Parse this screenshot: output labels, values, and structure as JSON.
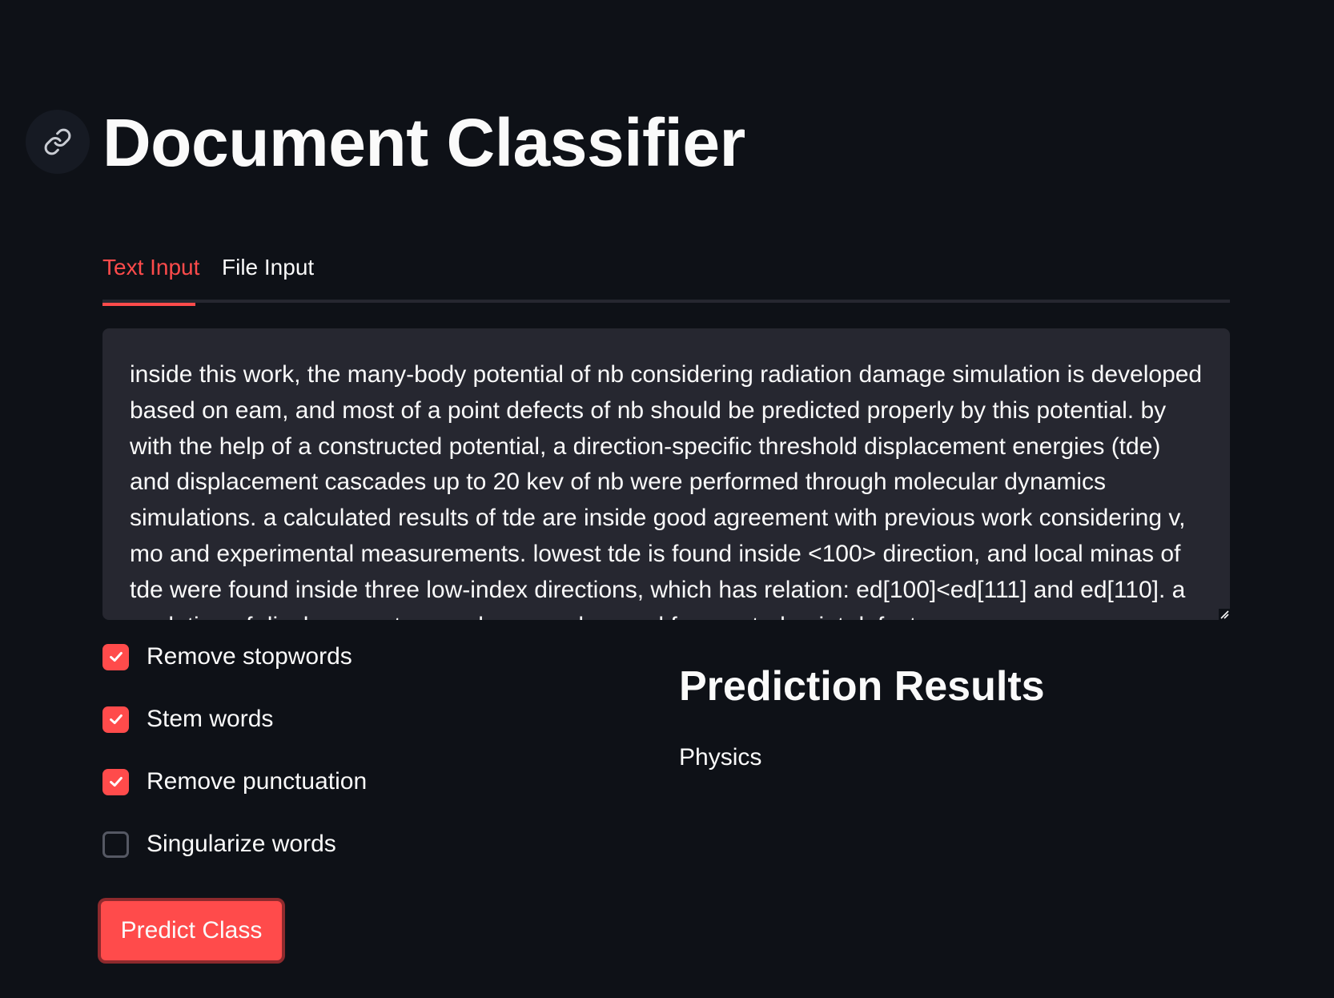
{
  "page": {
    "title": "Document Classifier",
    "anchor_icon": "link-icon"
  },
  "tabs": [
    {
      "label": "Text Input",
      "active": true
    },
    {
      "label": "File Input",
      "active": false
    }
  ],
  "text_input": {
    "value": "inside this work, the many-body potential of nb considering radiation damage simulation is developed based on eam, and most of a point defects of nb should be predicted properly by this potential. by with the help of a constructed potential, a direction-specific threshold displacement energies (tde) and displacement cascades up to 20 kev of nb were performed through molecular dynamics simulations. a calculated results of tde are inside good agreement with previous work considering v, mo and experimental measurements. lowest tde is found inside <100> direction, and local minas of tde were found inside three low-index directions, which has relation: ed[100]<ed[111] and ed[110]. a evolution of displacement cascades was observed for created point defects"
  },
  "options": [
    {
      "label": "Remove stopwords",
      "checked": true
    },
    {
      "label": "Stem words",
      "checked": true
    },
    {
      "label": "Remove punctuation",
      "checked": true
    },
    {
      "label": "Singularize words",
      "checked": false
    }
  ],
  "predict_button": {
    "label": "Predict Class"
  },
  "results": {
    "title": "Prediction Results",
    "value": "Physics"
  },
  "colors": {
    "background": "#0e1117",
    "accent": "#ff4b4b",
    "surface": "#262730",
    "text": "#fafafa"
  }
}
